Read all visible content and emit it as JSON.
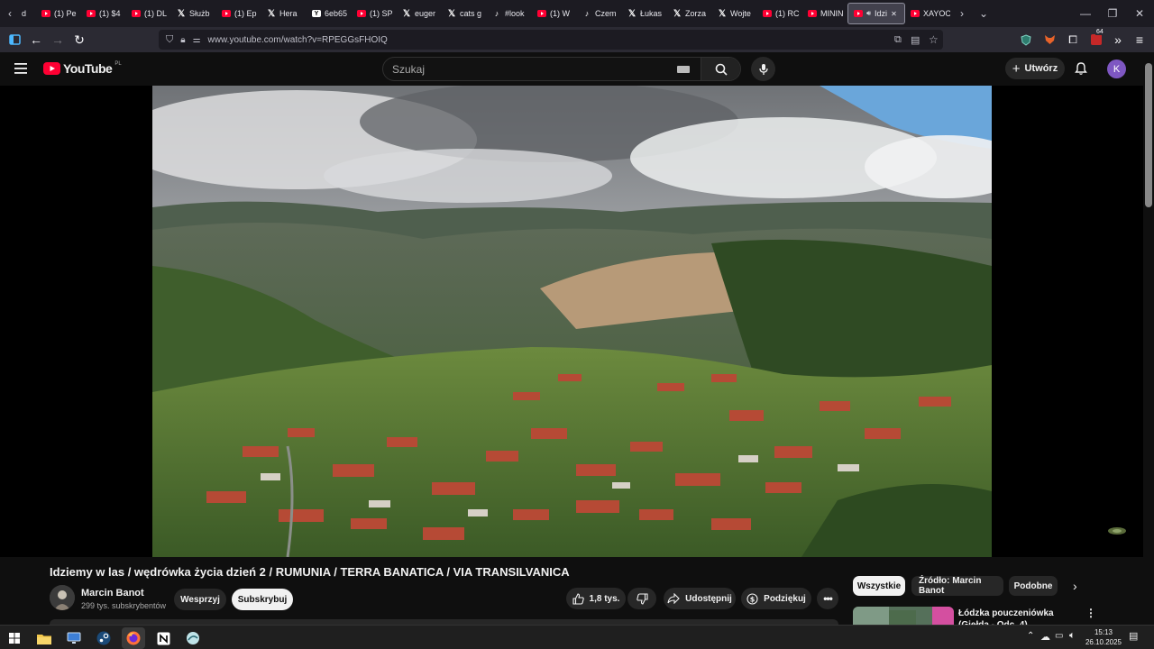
{
  "browser": {
    "tabs": [
      {
        "label": "(1) Pe",
        "icon": "youtube-icon"
      },
      {
        "label": "(1) $4",
        "icon": "youtube-icon"
      },
      {
        "label": "(1) DL",
        "icon": "youtube-icon"
      },
      {
        "label": "Służb",
        "icon": "x-icon"
      },
      {
        "label": "(1) Ep",
        "icon": "youtube-icon"
      },
      {
        "label": "Hera",
        "icon": "x-icon"
      },
      {
        "label": "6eb65",
        "icon": "xbox-icon"
      },
      {
        "label": "(1) SP",
        "icon": "youtube-icon"
      },
      {
        "label": "euger",
        "icon": "x-icon"
      },
      {
        "label": "cats g",
        "icon": "x-icon"
      },
      {
        "label": "#look",
        "icon": "tiktok-icon"
      },
      {
        "label": "(1) W",
        "icon": "youtube-icon"
      },
      {
        "label": "Czem",
        "icon": "tiktok-icon"
      },
      {
        "label": "Łukas",
        "icon": "x-icon"
      },
      {
        "label": "Zorza",
        "icon": "x-icon"
      },
      {
        "label": "Wojte",
        "icon": "x-icon"
      },
      {
        "label": "(1) RC",
        "icon": "youtube-icon"
      },
      {
        "label": "MININ",
        "icon": "youtube-icon"
      },
      {
        "label": "Idzi",
        "icon": "youtube-icon",
        "active": true
      },
      {
        "label": "XAYOC",
        "icon": "youtube-icon"
      }
    ],
    "url": "www.youtube.com/watch?v=RPEGGsFHOIQ",
    "extension_badge": "64"
  },
  "masthead": {
    "logo_text": "YouTube",
    "region": "PL",
    "search_placeholder": "Szukaj",
    "create_label": "Utwórz",
    "avatar_letter": "K"
  },
  "video": {
    "title": "Idziemy w las / wędrówka życia dzień 2 / RUMUNIA / TERRA BANATICA / VIA TRANSILVANICA",
    "channel_name": "Marcin Banot",
    "subscribers": "299 tys. subskrybentów",
    "support_label": "Wesprzyj",
    "subscribe_label": "Subskrybuj",
    "likes": "1,8 tys.",
    "share_label": "Udostępnij",
    "thanks_label": "Podziękuj"
  },
  "chips": [
    {
      "label": "Wszystkie",
      "active": true
    },
    {
      "label": "Źródło: Marcin Banot"
    },
    {
      "label": "Podobne"
    }
  ],
  "recommendation": {
    "title": "Łódzka pouczeniówka (Giełda - Odc. 4)"
  },
  "taskbar": {
    "time": "15:13",
    "date": "26.10.2025"
  }
}
